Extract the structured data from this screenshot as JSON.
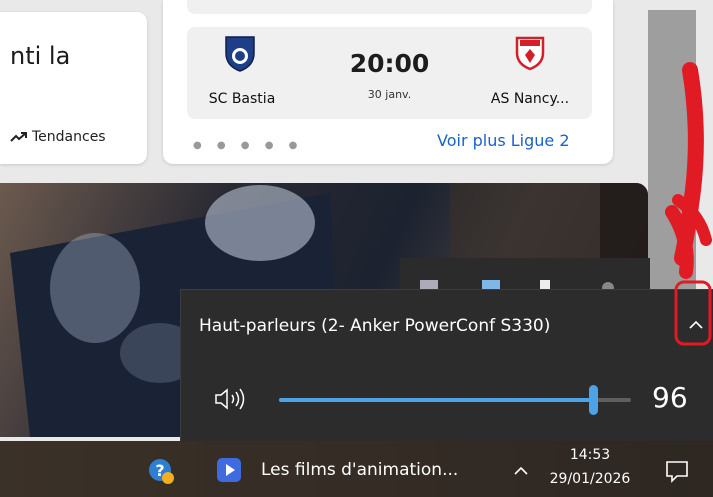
{
  "news": {
    "headline_fragment": "nti la",
    "trending_label": "Tendances",
    "trending_icon": "trending-up-icon"
  },
  "sports": {
    "home_team": "SC Bastia",
    "away_team": "AS Nancy...",
    "kickoff_time": "20:00",
    "match_date": "30 janv.",
    "more_link": "Voir plus Ligue 2",
    "pager_dots": "● ● ● ● ●",
    "home_crest_text": "S.C. BASTIA",
    "away_crest_text": "NANCY"
  },
  "volume_flyout": {
    "device_name": "Haut-parleurs (2- Anker PowerConf S330)",
    "volume": 96,
    "volume_label": "96",
    "accent": "#4ea3e6"
  },
  "taskbar": {
    "media_label": "Les films d'animation...",
    "time": "14:53",
    "date": "29/01/2026",
    "icons": [
      "help-icon",
      "media-player-icon",
      "tray-chevron-icon",
      "notification-icon"
    ]
  },
  "annotation_color": "#e01b24"
}
